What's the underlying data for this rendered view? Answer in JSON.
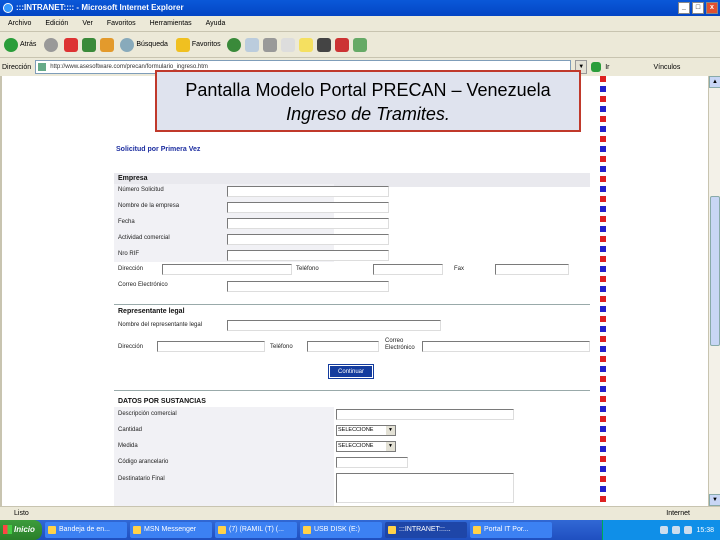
{
  "window": {
    "title": ":::INTRANET:::: - Microsoft Internet Explorer",
    "controls": [
      "_",
      "□",
      "x"
    ]
  },
  "menu": [
    "Archivo",
    "Edición",
    "Ver",
    "Favoritos",
    "Herramientas",
    "Ayuda"
  ],
  "toolbar": {
    "back_label": "Atrás",
    "search_label": "Búsqueda",
    "favorites_label": "Favoritos"
  },
  "addressbar": {
    "label": "Dirección",
    "url": "http://www.asesoftware.com/precan/formulario_ingreso.htm",
    "go_label": "Ir",
    "links_label": "Vínculos"
  },
  "callout": {
    "title": "Pantalla Modelo Portal PRECAN – Venezuela",
    "subtitle": "Ingreso de Tramites."
  },
  "form": {
    "heading": "Solicitud por Primera Vez",
    "company": {
      "section_title": "Empresa",
      "fields": [
        "Número Solicitud",
        "Nombre de la empresa",
        "Fecha",
        "Actividad comercial",
        "Nro RIF"
      ],
      "direccion": "Dirección",
      "telefono": "Teléfono",
      "fax": "Fax",
      "correo": "Correo Electrónico"
    },
    "legal_rep": {
      "section_title": "Representante legal",
      "name": "Nombre del representante legal",
      "direccion": "Dirección",
      "telefono": "Teléfono",
      "correo": "Correo Electrónico"
    },
    "continue_button": "Continuar",
    "substances": {
      "section_title": "DATOS POR SUSTANCIAS",
      "description": "Descripción comercial",
      "cantidad": "Cantidad",
      "medida": "Medida",
      "codigo": "Código arancelario",
      "destino": "Destinatario Final",
      "select_value": "SELECCIONE"
    }
  },
  "statusbar": {
    "text": "Listo",
    "zone": "Internet"
  },
  "taskbar": {
    "start": "Inicio",
    "tasks": [
      "Bandeja de en...",
      "MSN Messenger",
      "(7) (RAMIL (T) (...",
      "USB DISK (E:)",
      ":::INTRANET:::...",
      "Portal IT Por..."
    ],
    "active_index": 4,
    "clock": "15:38"
  }
}
